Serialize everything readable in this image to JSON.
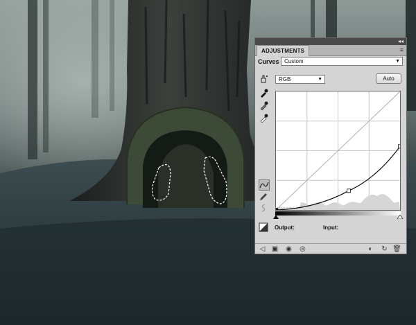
{
  "panel": {
    "tab_label": "ADJUSTMENTS",
    "collapse_glyph": "◂◂",
    "menu_glyph": "≡",
    "adjustment_type": "Curves",
    "preset_value": "Custom",
    "channel_value": "RGB",
    "auto_label": "Auto",
    "output_label": "Output:",
    "input_label": "Input:"
  },
  "curve": {
    "points": [
      [
        0,
        0
      ],
      [
        105,
        29
      ],
      [
        179,
        96
      ]
    ],
    "range": [
      0,
      179
    ]
  },
  "icons": {
    "hand_tool": "on-image-adjust-icon",
    "black_eyedropper": "black-point-eyedropper-icon",
    "gray_eyedropper": "gray-point-eyedropper-icon",
    "white_eyedropper": "white-point-eyedropper-icon",
    "curve_tool": "curve-points-icon",
    "pencil_tool": "pencil-draw-icon",
    "smooth_tool": "smooth-curve-icon",
    "clip_icon": "clip-options-icon"
  }
}
